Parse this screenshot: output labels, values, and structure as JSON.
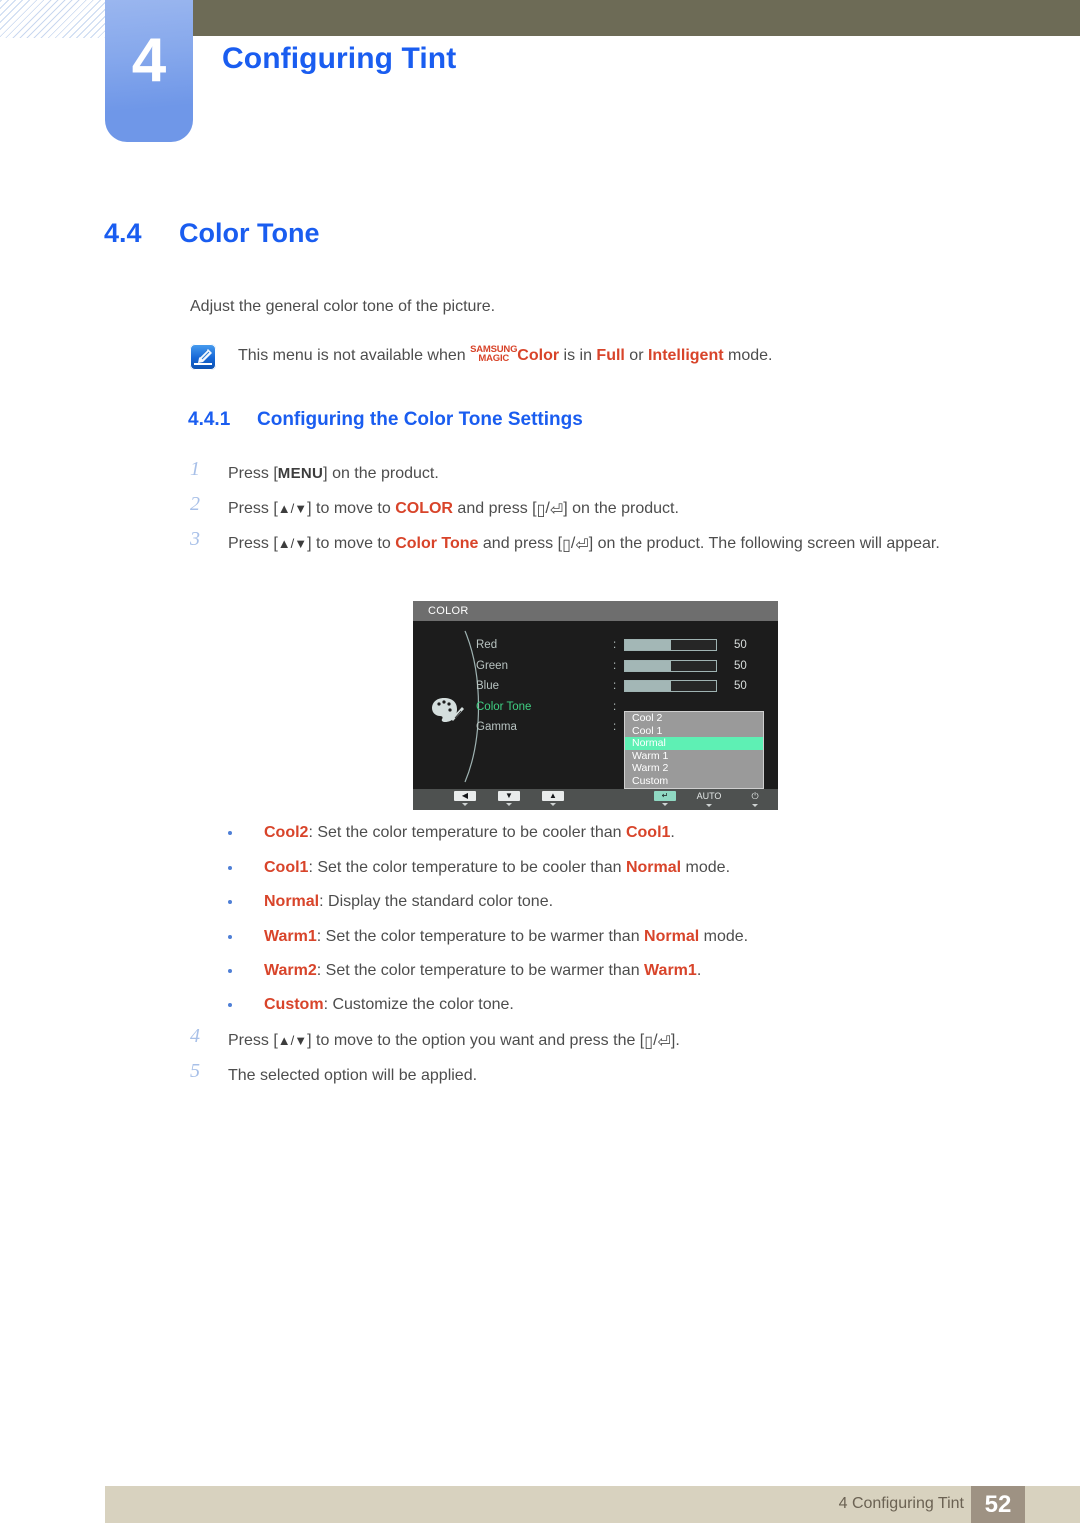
{
  "header": {
    "chapter_number": "4",
    "chapter_title": "Configuring Tint"
  },
  "section": {
    "number": "4.4",
    "title": "Color Tone",
    "intro": "Adjust the general color tone of the picture."
  },
  "note": {
    "icon": "note-pen-icon",
    "text_before": "This menu is not available when ",
    "magic_top": "SAMSUNG",
    "magic_bottom": "MAGIC",
    "magic_color_word": "Color",
    "text_mid": " is in ",
    "mode_1": "Full",
    "text_or": " or ",
    "mode_2": "Intelligent",
    "text_after": " mode."
  },
  "subsection": {
    "number": "4.4.1",
    "title": "Configuring the Color Tone Settings"
  },
  "steps": [
    {
      "n": "1",
      "html": "Press [<span class=\"kbd\">MENU</span>] on the product."
    },
    {
      "n": "2",
      "html": "Press [<span class=\"gl\">&#9650;/&#9660;</span>] to move to <span class=\"hl\">COLOR</span> and press [<span class=\"btnglyph\">&#9647;</span>/<span class=\"btnglyph\">&#9166;</span>] on the product."
    },
    {
      "n": "3",
      "html": "Press [<span class=\"gl\">&#9650;/&#9660;</span>] to move to <span class=\"hl\">Color Tone</span> and press [<span class=\"btnglyph\">&#9647;</span>/<span class=\"btnglyph\">&#9166;</span>] on the product. The following screen will appear."
    }
  ],
  "steps_tail": [
    {
      "n": "4",
      "html": "Press [<span class=\"gl\">&#9650;/&#9660;</span>] to move to the option you want and press the [<span class=\"btnglyph\">&#9647;</span>/<span class=\"btnglyph\">&#9166;</span>]."
    },
    {
      "n": "5",
      "html": "The selected option will be applied."
    }
  ],
  "osd": {
    "title": "COLOR",
    "rows": [
      {
        "label": "Red",
        "colon": ":",
        "value": "50",
        "fill_percent": 50,
        "highlighted": false
      },
      {
        "label": "Green",
        "colon": ":",
        "value": "50",
        "fill_percent": 50,
        "highlighted": false
      },
      {
        "label": "Blue",
        "colon": ":",
        "value": "50",
        "fill_percent": 50,
        "highlighted": false
      },
      {
        "label": "Color Tone",
        "colon": ":",
        "value": "",
        "fill_percent": 0,
        "highlighted": true
      },
      {
        "label": "Gamma",
        "colon": ":",
        "value": "",
        "fill_percent": 0,
        "highlighted": false
      }
    ],
    "dropdown": {
      "options": [
        "Cool 2",
        "Cool 1",
        "Normal",
        "Warm 1",
        "Warm 2",
        "Custom"
      ],
      "selected": "Normal"
    },
    "footer_buttons": [
      {
        "type": "box",
        "glyph": "◀",
        "name": "left-arrow"
      },
      {
        "type": "box",
        "glyph": "▼",
        "name": "down-arrow"
      },
      {
        "type": "box",
        "glyph": "▲",
        "name": "up-arrow"
      },
      {
        "type": "enter",
        "glyph": "↵",
        "name": "enter"
      },
      {
        "type": "text",
        "glyph": "AUTO",
        "name": "auto"
      },
      {
        "type": "text",
        "glyph": "⏻",
        "name": "power"
      }
    ],
    "palette_icon": "color-palette-icon"
  },
  "bullets": [
    {
      "term": "Cool2",
      "rest_pre": ": Set the color temperature to be cooler than ",
      "ref": "Cool1",
      "rest_post": "."
    },
    {
      "term": "Cool1",
      "rest_pre": ": Set the color temperature to be cooler than ",
      "ref": "Normal",
      "rest_post": " mode."
    },
    {
      "term": "Normal",
      "rest_pre": ": Display the standard color tone.",
      "ref": "",
      "rest_post": ""
    },
    {
      "term": "Warm1",
      "rest_pre": ": Set the color temperature to be warmer than ",
      "ref": "Normal",
      "rest_post": " mode."
    },
    {
      "term": "Warm2",
      "rest_pre": ": Set the color temperature to be warmer than ",
      "ref": "Warm1",
      "rest_post": "."
    },
    {
      "term": "Custom",
      "rest_pre": ": Customize the color tone.",
      "ref": "",
      "rest_post": ""
    }
  ],
  "footer": {
    "label": "4 Configuring Tint",
    "page": "52"
  },
  "colors": {
    "accent_blue": "#1a5df0",
    "chapter_box": "#6f97e8",
    "olive_bar": "#6d6b56",
    "highlight_red": "#d8442a",
    "footer_bar": "#d8d2bf",
    "page_box": "#9e9283",
    "osd_bg": "#1c1c1c",
    "osd_green": "#3fcf82",
    "osd_select": "#5ef0b4"
  }
}
